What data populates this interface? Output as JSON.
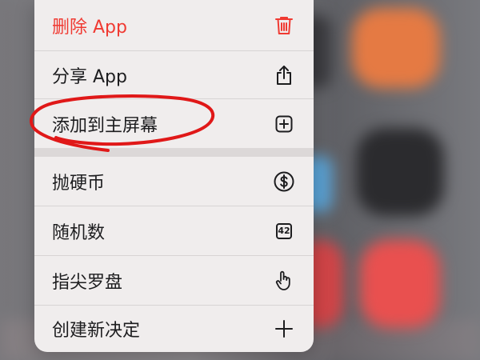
{
  "menu": {
    "items": [
      {
        "label": "删除 App",
        "icon": "trash-icon",
        "destructive": true
      },
      {
        "label": "分享 App",
        "icon": "share-icon"
      },
      {
        "label": "添加到主屏幕",
        "icon": "add-square-icon"
      },
      {
        "label": "抛硬币",
        "icon": "dollar-circle-icon"
      },
      {
        "label": "随机数",
        "icon": "number-box-icon",
        "icon_text": "42"
      },
      {
        "label": "指尖罗盘",
        "icon": "hand-point-icon"
      },
      {
        "label": "创建新决定",
        "icon": "plus-icon"
      }
    ]
  },
  "colors": {
    "destructive": "#f03a32",
    "text": "#1d1d1f",
    "menu_bg": "#f0eded",
    "annotation": "#e01818"
  }
}
